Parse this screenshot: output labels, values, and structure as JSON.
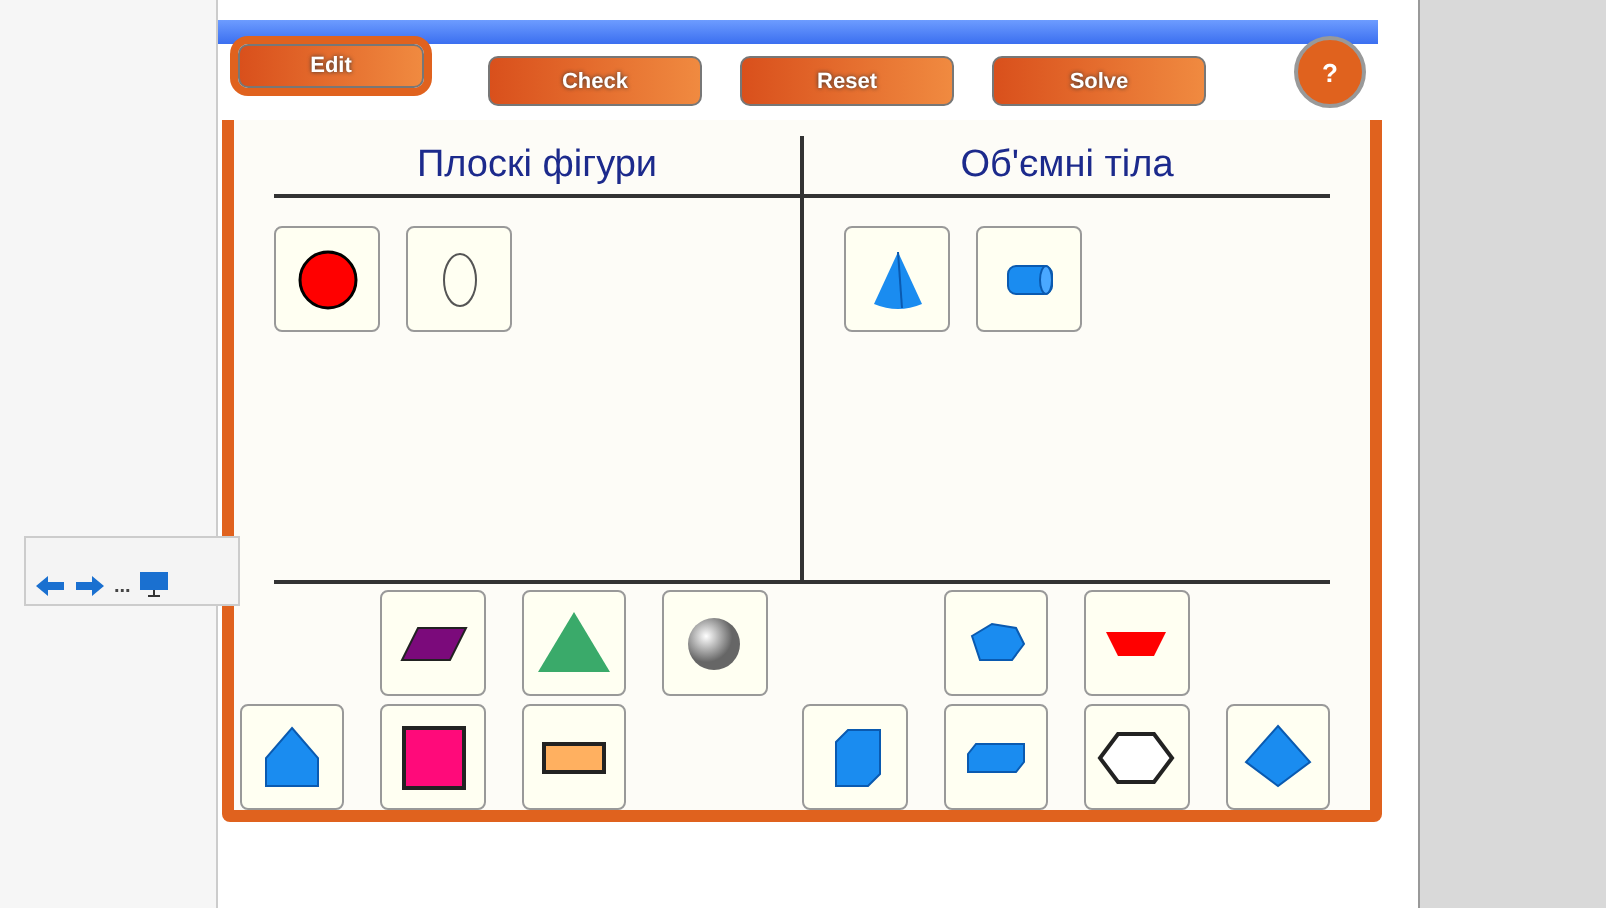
{
  "tabs": [
    {
      "label": "Edit",
      "selected": true
    },
    {
      "label": "Check",
      "selected": false
    },
    {
      "label": "Reset",
      "selected": false
    },
    {
      "label": "Solve",
      "selected": false
    }
  ],
  "help": "?",
  "columns": [
    {
      "heading": "Плоскі фігури",
      "tiles": [
        {
          "kind": "circle"
        },
        {
          "kind": "ellipse"
        }
      ]
    },
    {
      "heading": "Об'ємні тіла",
      "tiles": [
        {
          "kind": "cone"
        },
        {
          "kind": "cylinder"
        }
      ]
    }
  ],
  "tray": [
    [
      {
        "kind": "empty"
      },
      {
        "kind": "parallelogram"
      },
      {
        "kind": "triangle"
      },
      {
        "kind": "sphere"
      },
      {
        "kind": "empty"
      },
      {
        "kind": "polyhedron"
      },
      {
        "kind": "trapezoid"
      },
      {
        "kind": "empty"
      }
    ],
    [
      {
        "kind": "pentagon"
      },
      {
        "kind": "square"
      },
      {
        "kind": "rectangle"
      },
      {
        "kind": "empty"
      },
      {
        "kind": "cube"
      },
      {
        "kind": "cuboid"
      },
      {
        "kind": "hexagon"
      },
      {
        "kind": "bipyramid"
      }
    ]
  ],
  "toolbar": {
    "more": "..."
  }
}
